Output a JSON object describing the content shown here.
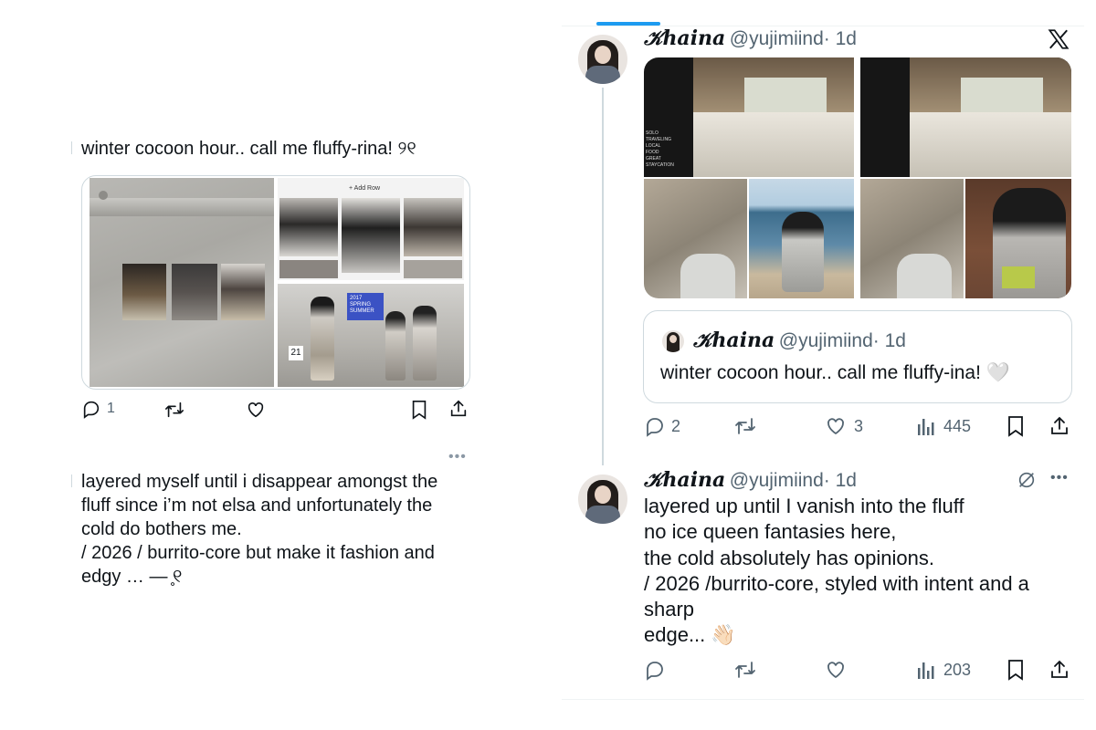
{
  "left": {
    "tweet1_text": "winter cocoon hour.. call me fluffy-rina! ୨୧",
    "tweet1_reply_count": "1",
    "collage": {
      "add_row_label": "+ Add Row",
      "board_label": "2017\nSPRING\nSUMMER",
      "board_number": "21"
    },
    "tweet2_text": "layered myself until i disappear amongst the\nfluff since i’m not elsa and unfortunately the\ncold do bothers me.\n/ 2026 / burrito-core but make it fashion and\nedgy  … —  ̥୧"
  },
  "right": {
    "author_name": "𝒦haina",
    "handle": "@yujimiind",
    "time": "· 1d",
    "grid_labels": [
      "SOLO\nTRAVELING",
      "LOCAL\nFOOD",
      "GREAT\nSTAYCATION"
    ],
    "quote": {
      "author_name": "𝒦haina",
      "handle": "@yujimiind",
      "time": "· 1d",
      "text": "winter cocoon hour.. call me fluffy-ina! 🤍"
    },
    "post1_actions": {
      "replies": "2",
      "likes": "3",
      "views": "445"
    },
    "post2": {
      "author_name": "𝒦haina",
      "handle": "@yujimiind",
      "time": "· 1d",
      "text": "layered up until I vanish into the fluff\nno ice queen fantasies here,\nthe cold absolutely has opinions.\n/ 2026 /burrito-core, styled with intent and a\nsharp\nedge... 👋🏻",
      "views": "203"
    }
  },
  "colors": {
    "accent": "#1d9bf0",
    "text": "#0f1419",
    "muted": "#536471",
    "border": "#cfd9de"
  }
}
